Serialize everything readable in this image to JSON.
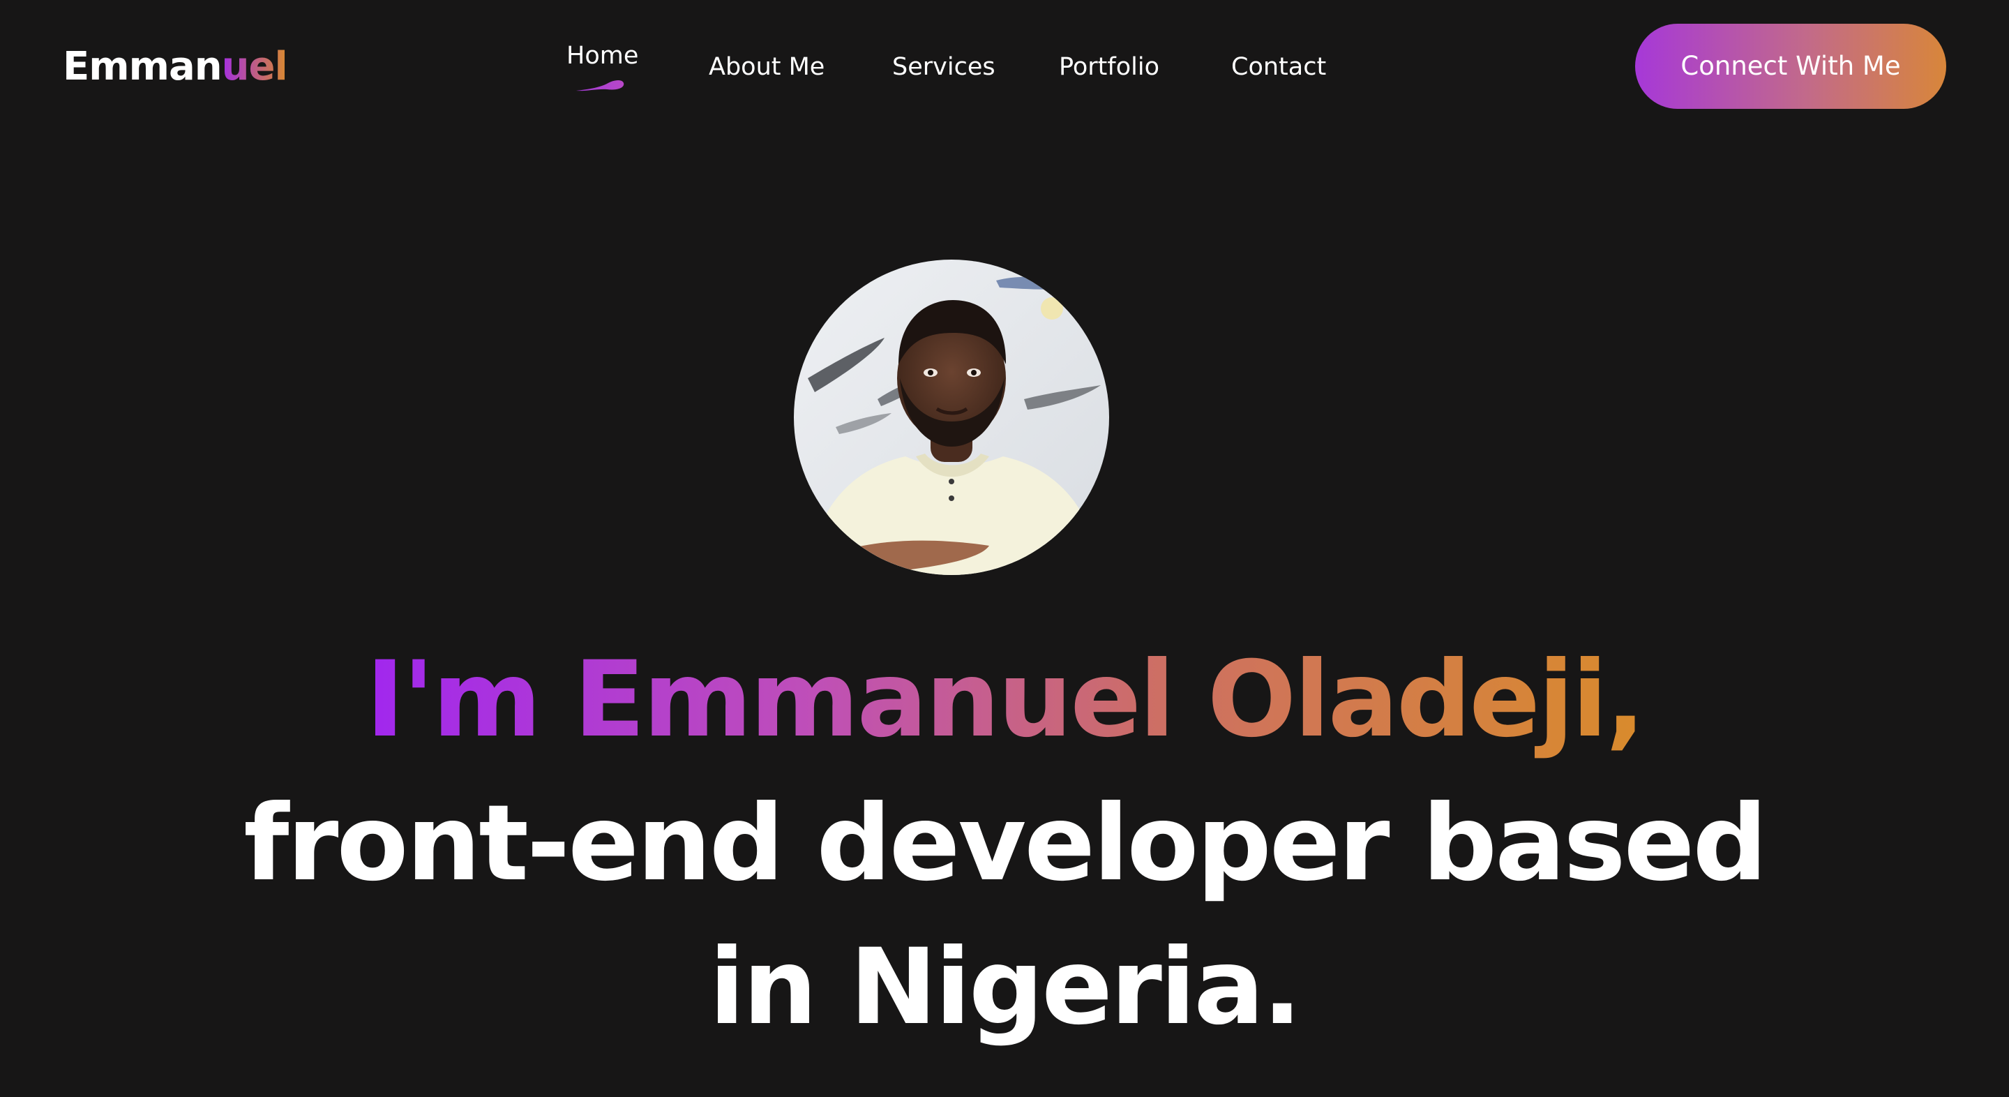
{
  "header": {
    "logo_part1": "Emman",
    "logo_part2": "uel"
  },
  "nav": {
    "items": [
      {
        "label": "Home",
        "active": true
      },
      {
        "label": "About Me"
      },
      {
        "label": "Services"
      },
      {
        "label": "Portfolio"
      },
      {
        "label": "Contact"
      }
    ]
  },
  "cta": {
    "label": "Connect With Me"
  },
  "hero": {
    "line1": "I'm Emmanuel Oladeji,",
    "line2": "front-end developer based",
    "line3": "in Nigeria."
  },
  "colors": {
    "background": "#171616",
    "gradient_start": "#a127ee",
    "gradient_end": "#d98b2c",
    "text": "#ffffff"
  },
  "icons": {
    "active_indicator": "brush-stroke-icon",
    "profile": "profile-photo"
  }
}
